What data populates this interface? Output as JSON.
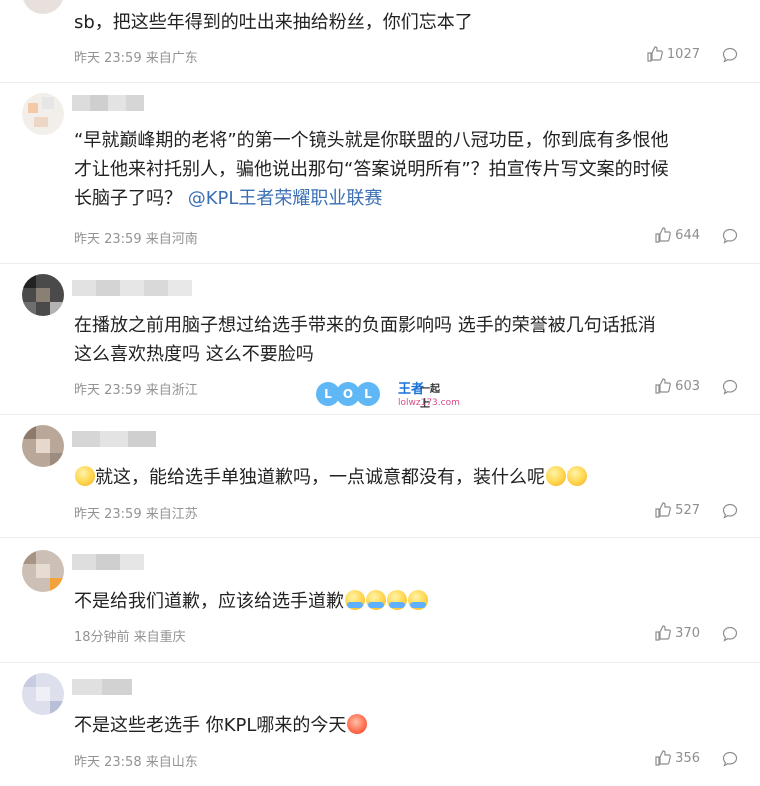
{
  "comments": [
    {
      "text": "sb，把这些年得到的吐出来抽给粉丝，你们忘本了",
      "meta": "昨天 23:59 来自广东",
      "likes": "1027",
      "emojis": []
    },
    {
      "text": "“早就巅峰期的老将”的第一个镜头就是你联盟的八冠功臣，你到底有多恨他\n才让他来衬托别人，骗他说出那句“答案说明所有”？拍宣传片写文案的时候\n长脑子了吗？",
      "mention": "@KPL王者荣耀职业联赛",
      "meta": "昨天 23:59 来自河南",
      "likes": "644"
    },
    {
      "text": "在播放之前用脑子想过给选手带来的负面影响吗 选手的荣誉被几句话抵消\n这么喜欢热度吗 这么不要脸吗",
      "meta": "昨天 23:59 来自浙江",
      "likes": "603"
    },
    {
      "text": "就这，能给选手单独道歉吗，一点诚意都没有，装什么呢",
      "meta": "昨天 23:59 来自江苏",
      "likes": "527"
    },
    {
      "text": "不是给我们道歉，应该给选手道歉",
      "meta": "18分钟前 来自重庆",
      "likes": "370"
    },
    {
      "text": "不是这些老选手 你KPL哪来的今天",
      "meta": "昨天 23:58 来自山东",
      "likes": "356"
    }
  ],
  "watermark": {
    "letters": [
      "L",
      "O",
      "L"
    ],
    "brand": "王者",
    "tag": "一起上",
    "url": "lolwz173.com"
  },
  "icons": {
    "like": "thumbs-up-icon",
    "reply": "comment-bubble-icon"
  },
  "colors": {
    "mention": "#3b6fb6",
    "meta": "#939393"
  }
}
